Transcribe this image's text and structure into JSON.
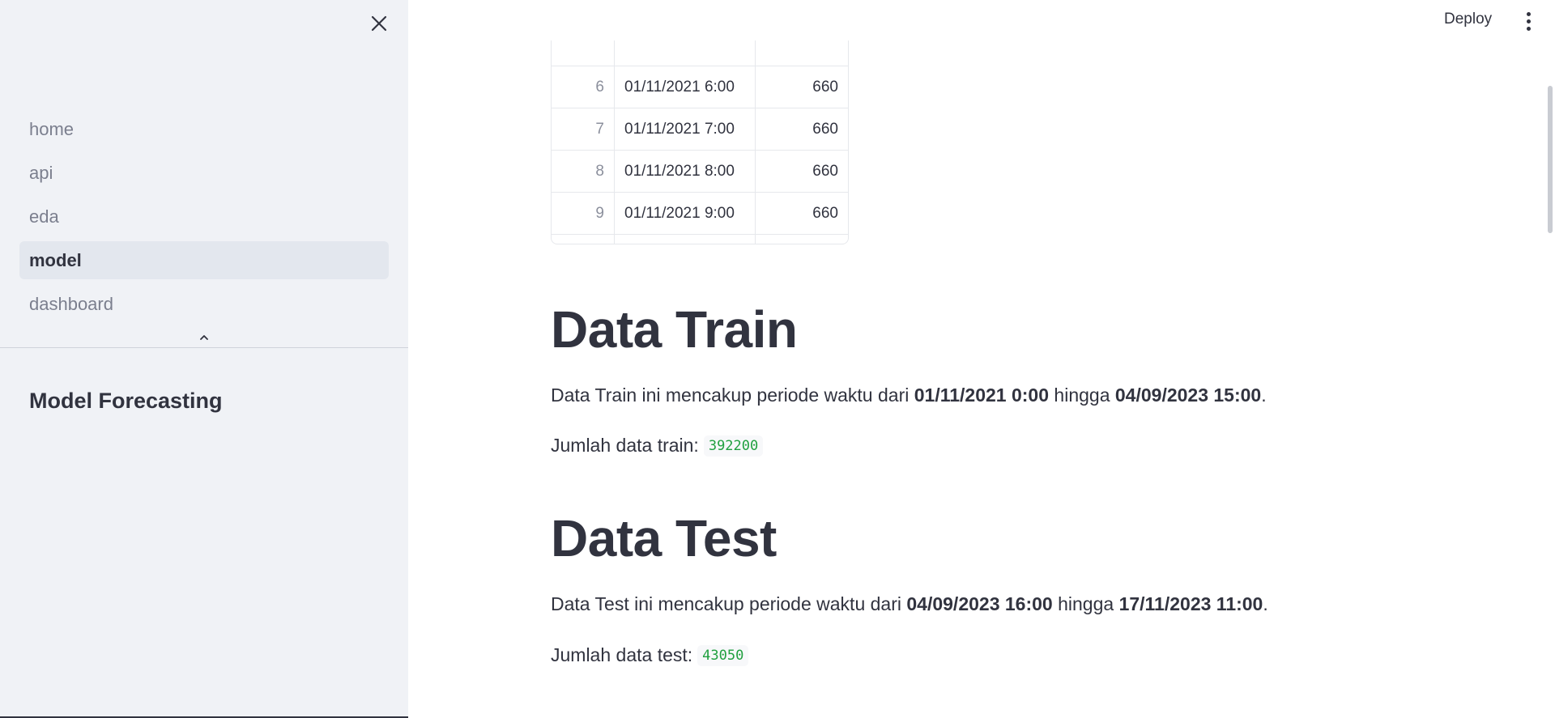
{
  "sidebar": {
    "nav": [
      {
        "label": "home"
      },
      {
        "label": "api"
      },
      {
        "label": "eda"
      },
      {
        "label": "model"
      },
      {
        "label": "dashboard"
      }
    ],
    "active": "model",
    "title": "Model Forecasting"
  },
  "header": {
    "deploy_label": "Deploy"
  },
  "table": {
    "rows": [
      {
        "index": "6",
        "date": "01/11/2021 6:00",
        "value": "660"
      },
      {
        "index": "7",
        "date": "01/11/2021 7:00",
        "value": "660"
      },
      {
        "index": "8",
        "date": "01/11/2021 8:00",
        "value": "660"
      },
      {
        "index": "9",
        "date": "01/11/2021 9:00",
        "value": "660"
      }
    ]
  },
  "train": {
    "heading": "Data Train",
    "text_prefix": "Data Train ini mencakup periode waktu dari ",
    "start": "01/11/2021 0:00",
    "mid": " hingga ",
    "end": "04/09/2023 15:00",
    "suffix": ".",
    "count_label": "Jumlah data train:",
    "count": "392200"
  },
  "test": {
    "heading": "Data Test",
    "text_prefix": "Data Test ini mencakup periode waktu dari ",
    "start": "04/09/2023 16:00",
    "mid": " hingga ",
    "end": "17/11/2023 11:00",
    "suffix": ".",
    "count_label": "Jumlah data test:",
    "count": "43050"
  },
  "colors": {
    "sidebar_bg": "#f0f2f6",
    "text": "#31333f",
    "code_green": "#21a040"
  }
}
